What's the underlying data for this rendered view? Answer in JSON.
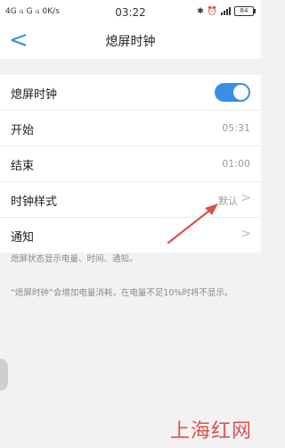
{
  "status_bar": {
    "left": "4G ᵢ₁ G ᵢ₁ 0K/s",
    "time": "03:22",
    "battery": "84"
  },
  "nav": {
    "back": "<",
    "title": "熄屏时钟"
  },
  "rows": {
    "aod": {
      "label": "熄屏时钟",
      "toggle_on": true
    },
    "start": {
      "label": "开始",
      "value": "05:31"
    },
    "end": {
      "label": "结束",
      "value": "01:00"
    },
    "style": {
      "label": "时钟样式",
      "value": "默认",
      "chevron": ">"
    },
    "notify": {
      "label": "通知",
      "chevron": ">"
    }
  },
  "notes": {
    "status": "熄屏状态显示电量、时间、通知。",
    "power": "“熄屏时钟”会增加电量消耗，在电量不足10%时将不显示。"
  },
  "watermark": "上海红网",
  "colors": {
    "accent": "#3a8ee6",
    "annotation": "#d9534f"
  }
}
